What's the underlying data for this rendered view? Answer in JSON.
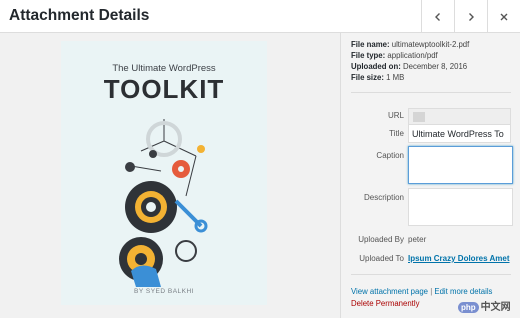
{
  "header": {
    "title": "Attachment Details",
    "prev_icon": "chevron-left-icon",
    "next_icon": "chevron-right-icon",
    "close_icon": "close-icon"
  },
  "preview": {
    "subtitle": "The Ultimate WordPress",
    "title": "TOOLKIT",
    "author": "BY SYED BALKHI"
  },
  "meta": {
    "file_name_label": "File name:",
    "file_name": "ultimatewptoolkit-2.pdf",
    "file_type_label": "File type:",
    "file_type": "application/pdf",
    "uploaded_on_label": "Uploaded on:",
    "uploaded_on": "December 8, 2016",
    "file_size_label": "File size:",
    "file_size": "1 MB"
  },
  "fields": {
    "url_label": "URL",
    "title_label": "Title",
    "title_value": "Ultimate WordPress To",
    "caption_label": "Caption",
    "caption_value": "",
    "description_label": "Description",
    "description_value": "",
    "uploaded_by_label": "Uploaded By",
    "uploaded_by": "peter",
    "uploaded_to_label": "Uploaded To",
    "uploaded_to": "Ipsum Crazy Dolores Amet"
  },
  "actions": {
    "view_attachment": "View attachment page",
    "separator": "|",
    "edit_more": "Edit more details",
    "delete": "Delete Permanently"
  },
  "watermark": {
    "badge": "php",
    "text": "中文网"
  },
  "colors": {
    "link": "#0073aa",
    "delete": "#aa0000",
    "focus": "#5b9dd9"
  }
}
